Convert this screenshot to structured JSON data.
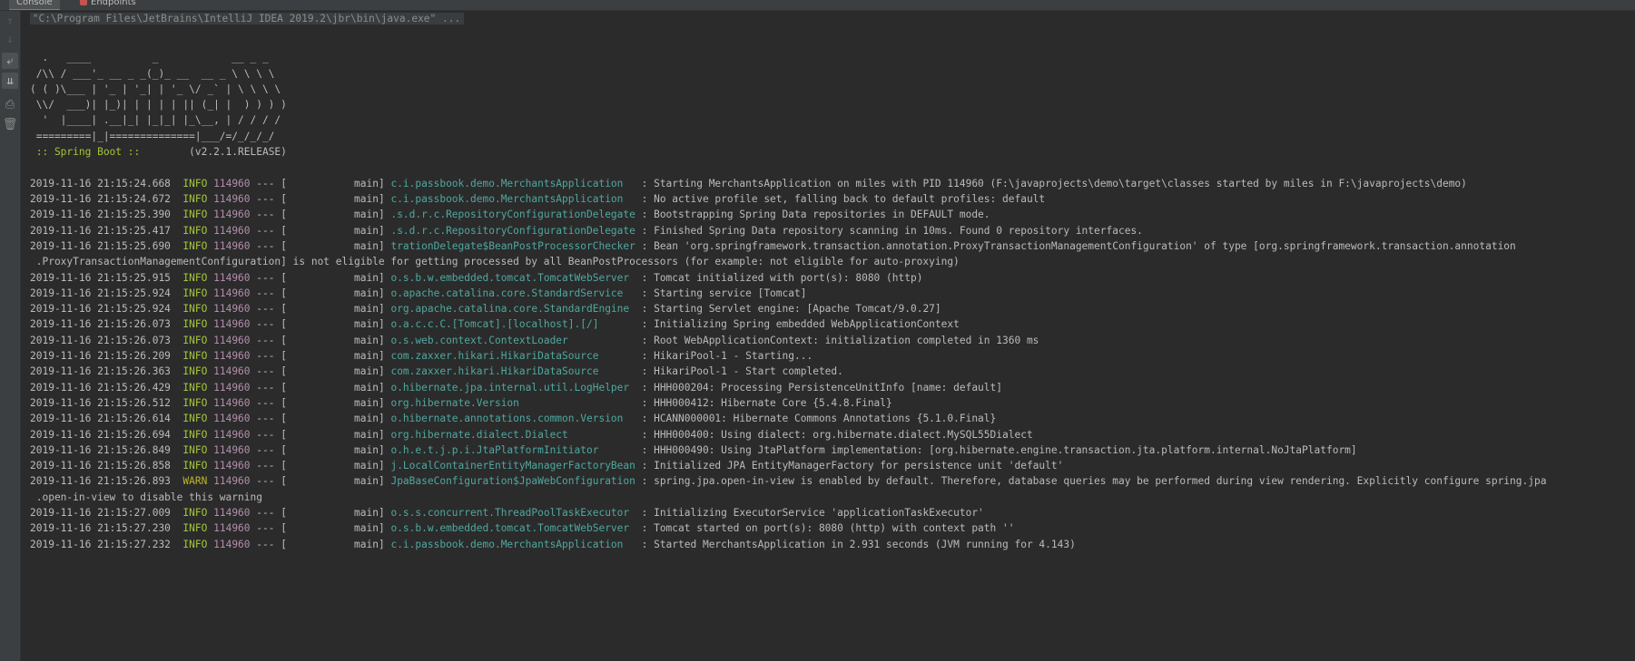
{
  "tabs": [
    {
      "label": "Console",
      "active": true
    },
    {
      "label": "Endpoints",
      "active": false
    }
  ],
  "toolbar": {
    "items": [
      {
        "name": "scroll-up-icon",
        "glyph": "↑",
        "state": "disabled"
      },
      {
        "name": "scroll-down-icon",
        "glyph": "↓",
        "state": "disabled"
      },
      {
        "name": "soft-wrap-icon",
        "glyph": "⤶",
        "state": "toggled"
      },
      {
        "name": "scroll-to-end-icon",
        "glyph": "⇊",
        "state": "toggled"
      },
      {
        "name": "print-icon",
        "glyph": "⎙",
        "state": "normal"
      },
      {
        "name": "clear-all-icon",
        "glyph": "🗑",
        "state": "normal"
      }
    ]
  },
  "console": {
    "command": "\"C:\\Program Files\\JetBrains\\IntelliJ IDEA 2019.2\\jbr\\bin\\java.exe\" ...",
    "banner": [
      "  .   ____          _            __ _ _",
      " /\\\\ / ___'_ __ _ _(_)_ __  __ _ \\ \\ \\ \\",
      "( ( )\\___ | '_ | '_| | '_ \\/ _` | \\ \\ \\ \\",
      " \\\\/  ___)| |_)| | | | | || (_| |  ) ) ) )",
      "  '  |____| .__|_| |_|_| |_\\__, | / / / /",
      " =========|_|==============|___/=/_/_/_/"
    ],
    "spring_tag": " :: Spring Boot :: ",
    "spring_version": "       (v2.2.1.RELEASE)",
    "logs": [
      {
        "ts": "2019-11-16 21:15:24.668",
        "level": "INFO",
        "pid": "114960",
        "thread": " --- [           main] ",
        "logger": "c.i.passbook.demo.MerchantsApplication  ",
        "msg": " : Starting MerchantsApplication on miles with PID 114960 (F:\\javaprojects\\demo\\target\\classes started by miles in F:\\javaprojects\\demo)"
      },
      {
        "ts": "2019-11-16 21:15:24.672",
        "level": "INFO",
        "pid": "114960",
        "thread": " --- [           main] ",
        "logger": "c.i.passbook.demo.MerchantsApplication  ",
        "msg": " : No active profile set, falling back to default profiles: default"
      },
      {
        "ts": "2019-11-16 21:15:25.390",
        "level": "INFO",
        "pid": "114960",
        "thread": " --- [           main] ",
        "logger": ".s.d.r.c.RepositoryConfigurationDelegate",
        "msg": " : Bootstrapping Spring Data repositories in DEFAULT mode."
      },
      {
        "ts": "2019-11-16 21:15:25.417",
        "level": "INFO",
        "pid": "114960",
        "thread": " --- [           main] ",
        "logger": ".s.d.r.c.RepositoryConfigurationDelegate",
        "msg": " : Finished Spring Data repository scanning in 10ms. Found 0 repository interfaces."
      },
      {
        "ts": "2019-11-16 21:15:25.690",
        "level": "INFO",
        "pid": "114960",
        "thread": " --- [           main] ",
        "logger": "trationDelegate$BeanPostProcessorChecker",
        "msg": " : Bean 'org.springframework.transaction.annotation.ProxyTransactionManagementConfiguration' of type [org.springframework.transaction.annotation",
        "cont": " .ProxyTransactionManagementConfiguration] is not eligible for getting processed by all BeanPostProcessors (for example: not eligible for auto-proxying)"
      },
      {
        "ts": "2019-11-16 21:15:25.915",
        "level": "INFO",
        "pid": "114960",
        "thread": " --- [           main] ",
        "logger": "o.s.b.w.embedded.tomcat.TomcatWebServer ",
        "msg": " : Tomcat initialized with port(s): 8080 (http)"
      },
      {
        "ts": "2019-11-16 21:15:25.924",
        "level": "INFO",
        "pid": "114960",
        "thread": " --- [           main] ",
        "logger": "o.apache.catalina.core.StandardService  ",
        "msg": " : Starting service [Tomcat]"
      },
      {
        "ts": "2019-11-16 21:15:25.924",
        "level": "INFO",
        "pid": "114960",
        "thread": " --- [           main] ",
        "logger": "org.apache.catalina.core.StandardEngine ",
        "msg": " : Starting Servlet engine: [Apache Tomcat/9.0.27]"
      },
      {
        "ts": "2019-11-16 21:15:26.073",
        "level": "INFO",
        "pid": "114960",
        "thread": " --- [           main] ",
        "logger": "o.a.c.c.C.[Tomcat].[localhost].[/]      ",
        "msg": " : Initializing Spring embedded WebApplicationContext"
      },
      {
        "ts": "2019-11-16 21:15:26.073",
        "level": "INFO",
        "pid": "114960",
        "thread": " --- [           main] ",
        "logger": "o.s.web.context.ContextLoader           ",
        "msg": " : Root WebApplicationContext: initialization completed in 1360 ms"
      },
      {
        "ts": "2019-11-16 21:15:26.209",
        "level": "INFO",
        "pid": "114960",
        "thread": " --- [           main] ",
        "logger": "com.zaxxer.hikari.HikariDataSource      ",
        "msg": " : HikariPool-1 - Starting..."
      },
      {
        "ts": "2019-11-16 21:15:26.363",
        "level": "INFO",
        "pid": "114960",
        "thread": " --- [           main] ",
        "logger": "com.zaxxer.hikari.HikariDataSource      ",
        "msg": " : HikariPool-1 - Start completed."
      },
      {
        "ts": "2019-11-16 21:15:26.429",
        "level": "INFO",
        "pid": "114960",
        "thread": " --- [           main] ",
        "logger": "o.hibernate.jpa.internal.util.LogHelper ",
        "msg": " : HHH000204: Processing PersistenceUnitInfo [name: default]"
      },
      {
        "ts": "2019-11-16 21:15:26.512",
        "level": "INFO",
        "pid": "114960",
        "thread": " --- [           main] ",
        "logger": "org.hibernate.Version                   ",
        "msg": " : HHH000412: Hibernate Core {5.4.8.Final}"
      },
      {
        "ts": "2019-11-16 21:15:26.614",
        "level": "INFO",
        "pid": "114960",
        "thread": " --- [           main] ",
        "logger": "o.hibernate.annotations.common.Version  ",
        "msg": " : HCANN000001: Hibernate Commons Annotations {5.1.0.Final}"
      },
      {
        "ts": "2019-11-16 21:15:26.694",
        "level": "INFO",
        "pid": "114960",
        "thread": " --- [           main] ",
        "logger": "org.hibernate.dialect.Dialect           ",
        "msg": " : HHH000400: Using dialect: org.hibernate.dialect.MySQL55Dialect"
      },
      {
        "ts": "2019-11-16 21:15:26.849",
        "level": "INFO",
        "pid": "114960",
        "thread": " --- [           main] ",
        "logger": "o.h.e.t.j.p.i.JtaPlatformInitiator      ",
        "msg": " : HHH000490: Using JtaPlatform implementation: [org.hibernate.engine.transaction.jta.platform.internal.NoJtaPlatform]"
      },
      {
        "ts": "2019-11-16 21:15:26.858",
        "level": "INFO",
        "pid": "114960",
        "thread": " --- [           main] ",
        "logger": "j.LocalContainerEntityManagerFactoryBean",
        "msg": " : Initialized JPA EntityManagerFactory for persistence unit 'default'"
      },
      {
        "ts": "2019-11-16 21:15:26.893",
        "level": "WARN",
        "pid": "114960",
        "thread": " --- [           main] ",
        "logger": "JpaBaseConfiguration$JpaWebConfiguration",
        "msg": " : spring.jpa.open-in-view is enabled by default. Therefore, database queries may be performed during view rendering. Explicitly configure spring.jpa",
        "cont": " .open-in-view to disable this warning"
      },
      {
        "ts": "2019-11-16 21:15:27.009",
        "level": "INFO",
        "pid": "114960",
        "thread": " --- [           main] ",
        "logger": "o.s.s.concurrent.ThreadPoolTaskExecutor ",
        "msg": " : Initializing ExecutorService 'applicationTaskExecutor'"
      },
      {
        "ts": "2019-11-16 21:15:27.230",
        "level": "INFO",
        "pid": "114960",
        "thread": " --- [           main] ",
        "logger": "o.s.b.w.embedded.tomcat.TomcatWebServer ",
        "msg": " : Tomcat started on port(s): 8080 (http) with context path ''"
      },
      {
        "ts": "2019-11-16 21:15:27.232",
        "level": "INFO",
        "pid": "114960",
        "thread": " --- [           main] ",
        "logger": "c.i.passbook.demo.MerchantsApplication  ",
        "msg": " : Started MerchantsApplication in 2.931 seconds (JVM running for 4.143)"
      }
    ]
  },
  "colors": {
    "background": "#2b2b2b",
    "panel": "#3c3f41",
    "text": "#bbbbbb",
    "info": "#a4c639",
    "warn": "#bbb529",
    "pid": "#b48ead",
    "logger": "#4fa8a0"
  }
}
